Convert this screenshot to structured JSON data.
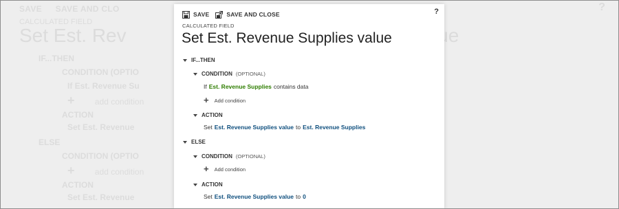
{
  "toolbar": {
    "save_label": "SAVE",
    "save_close_label": "SAVE AND CLOSE",
    "help_label": "?"
  },
  "header": {
    "caption": "CALCULATED FIELD",
    "title": "Set Est. Revenue Supplies value"
  },
  "if_block": {
    "header": "IF...THEN",
    "condition": {
      "header": "CONDITION",
      "optional": "(OPTIONAL)",
      "if_word": "If",
      "field": "Est. Revenue Supplies",
      "operator": "contains data",
      "add_label": "Add condition"
    },
    "action": {
      "header": "ACTION",
      "set_word": "Set",
      "target": "Est. Revenue Supplies value",
      "to_word": "to",
      "value": "Est. Revenue Supplies"
    }
  },
  "else_block": {
    "header": "ELSE",
    "condition": {
      "header": "CONDITION",
      "optional": "(OPTIONAL)",
      "add_label": "Add condition"
    },
    "action": {
      "header": "ACTION",
      "set_word": "Set",
      "target": "Est. Revenue Supplies value",
      "to_word": "to",
      "value": "0"
    }
  },
  "background": {
    "toolbar_save": "SAVE",
    "toolbar_save_close": "SAVE AND CLO",
    "caption": "CALCULATED FIELD",
    "title_left": "Set Est. Rev",
    "title_right": "lue",
    "if_header": "IF...THEN",
    "condition": "CONDITION (OPTIO",
    "if_field": "If Est. Revenue Su",
    "add_condition": "add condition",
    "action": "ACTION",
    "set_field": "Set Est. Revenue",
    "else_header": "ELSE",
    "else_condition": "CONDITION (OPTIO",
    "else_add_condition": "add condition",
    "else_action": "ACTION",
    "else_set_field": "Set Est. Revenue"
  },
  "colors": {
    "field_green": "#2e7d00",
    "field_blue": "#0f4f7e"
  }
}
